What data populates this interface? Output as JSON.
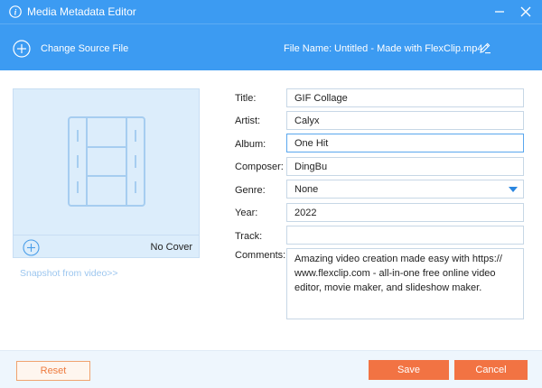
{
  "window": {
    "title": "Media Metadata Editor",
    "icons": {
      "info": "info-icon",
      "minimize": "minimize-icon",
      "close": "close-icon"
    }
  },
  "toolbar": {
    "change_source_label": "Change Source File",
    "file_name_label": "File Name:",
    "file_name_value": "Untitled - Made with FlexClip.mp4",
    "icons": {
      "add": "plus-circle-icon",
      "edit": "pencil-icon"
    }
  },
  "cover": {
    "no_cover_label": "No Cover",
    "snapshot_link": "Snapshot from video>>",
    "icons": {
      "placeholder": "film-strip-icon",
      "add": "plus-circle-icon"
    }
  },
  "form": {
    "title": {
      "label": "Title:",
      "value": "GIF Collage"
    },
    "artist": {
      "label": "Artist:",
      "value": "Calyx"
    },
    "album": {
      "label": "Album:",
      "value": "One Hit"
    },
    "composer": {
      "label": "Composer:",
      "value": "DingBu"
    },
    "genre": {
      "label": "Genre:",
      "value": "None"
    },
    "year": {
      "label": "Year:",
      "value": "2022"
    },
    "track": {
      "label": "Track:",
      "value": ""
    },
    "comments": {
      "label": "Comments:",
      "value": "Amazing video creation made easy with https:// www.flexclip.com - all-in-one free online video editor, movie maker, and slideshow maker."
    }
  },
  "buttons": {
    "reset": "Reset",
    "save": "Save",
    "cancel": "Cancel"
  },
  "colors": {
    "header_blue": "#3c9bf2",
    "accent_orange": "#f27343",
    "cover_bg": "#dcedfb",
    "footer_bg": "#eef6fd"
  }
}
